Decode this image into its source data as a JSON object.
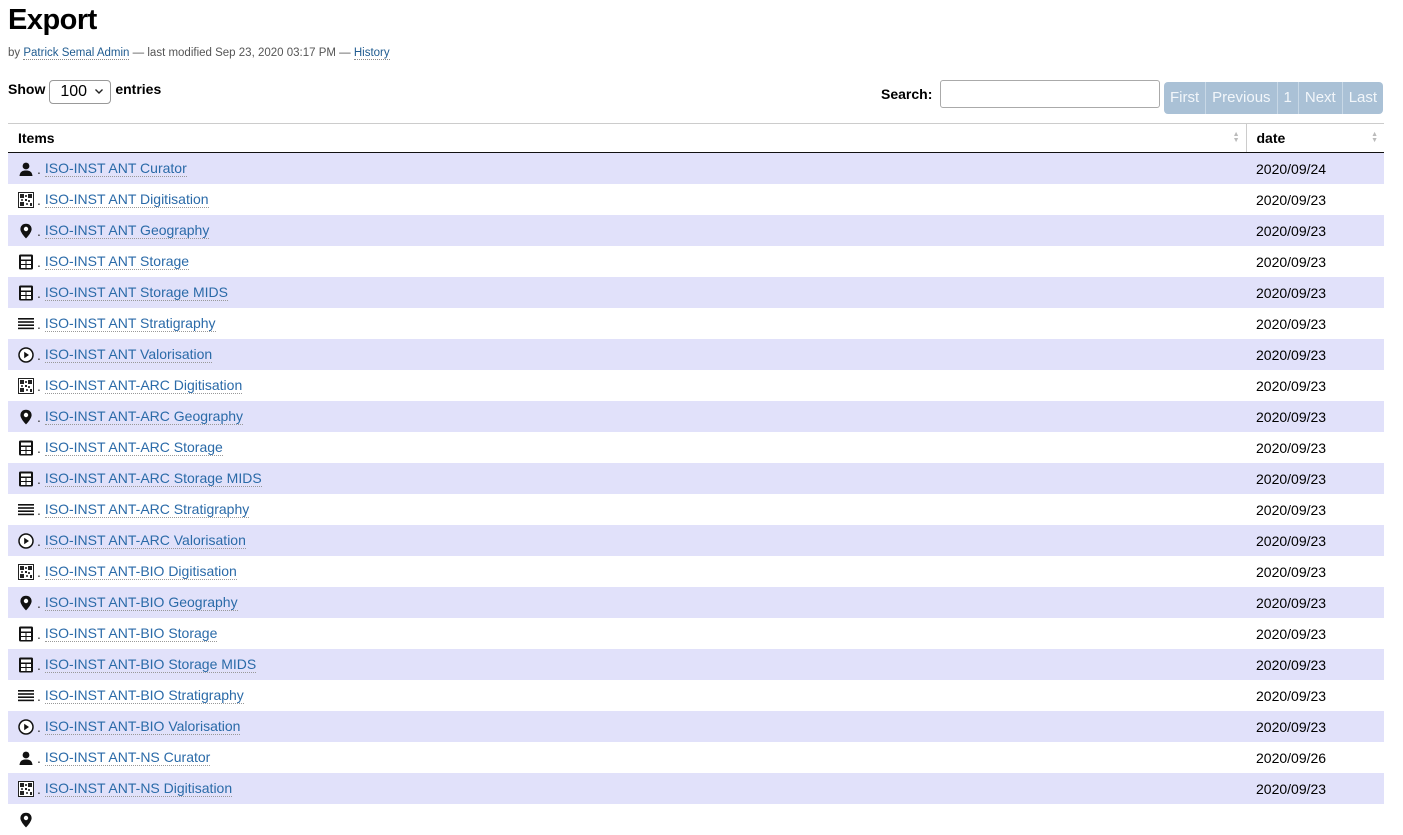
{
  "page": {
    "title": "Export",
    "byline_prefix": "by",
    "author": "Patrick Semal Admin",
    "modified": "— last modified Sep 23, 2020 03:17 PM —",
    "history": "History"
  },
  "controls": {
    "show_label": "Show",
    "entries_value": "100",
    "entries_label": "entries",
    "search_label": "Search:",
    "search_value": "",
    "pager": [
      "First",
      "Previous",
      "1",
      "Next",
      "Last"
    ]
  },
  "table": {
    "columns": [
      "Items",
      "date"
    ],
    "rows": [
      {
        "icon": "person-icon",
        "label": "ISO-INST ANT Curator",
        "date": "2020/09/24"
      },
      {
        "icon": "qr-code-icon",
        "label": "ISO-INST ANT Digitisation",
        "date": "2020/09/23"
      },
      {
        "icon": "map-pin-icon",
        "label": "ISO-INST ANT Geography",
        "date": "2020/09/23"
      },
      {
        "icon": "storage-cabinet-icon",
        "label": "ISO-INST ANT Storage",
        "date": "2020/09/23"
      },
      {
        "icon": "storage-cabinet-icon",
        "label": "ISO-INST ANT Storage MIDS",
        "date": "2020/09/23"
      },
      {
        "icon": "stratigraphy-layers-icon",
        "label": "ISO-INST ANT Stratigraphy",
        "date": "2020/09/23"
      },
      {
        "icon": "play-circle-icon",
        "label": "ISO-INST ANT Valorisation",
        "date": "2020/09/23"
      },
      {
        "icon": "qr-code-icon",
        "label": "ISO-INST ANT-ARC Digitisation",
        "date": "2020/09/23"
      },
      {
        "icon": "map-pin-icon",
        "label": "ISO-INST ANT-ARC Geography",
        "date": "2020/09/23"
      },
      {
        "icon": "storage-cabinet-icon",
        "label": "ISO-INST ANT-ARC Storage",
        "date": "2020/09/23"
      },
      {
        "icon": "storage-cabinet-icon",
        "label": "ISO-INST ANT-ARC Storage MIDS",
        "date": "2020/09/23"
      },
      {
        "icon": "stratigraphy-layers-icon",
        "label": "ISO-INST ANT-ARC Stratigraphy",
        "date": "2020/09/23"
      },
      {
        "icon": "play-circle-icon",
        "label": "ISO-INST ANT-ARC Valorisation",
        "date": "2020/09/23"
      },
      {
        "icon": "qr-code-icon",
        "label": "ISO-INST ANT-BIO Digitisation",
        "date": "2020/09/23"
      },
      {
        "icon": "map-pin-icon",
        "label": "ISO-INST ANT-BIO Geography",
        "date": "2020/09/23"
      },
      {
        "icon": "storage-cabinet-icon",
        "label": "ISO-INST ANT-BIO Storage",
        "date": "2020/09/23"
      },
      {
        "icon": "storage-cabinet-icon",
        "label": "ISO-INST ANT-BIO Storage MIDS",
        "date": "2020/09/23"
      },
      {
        "icon": "stratigraphy-layers-icon",
        "label": "ISO-INST ANT-BIO Stratigraphy",
        "date": "2020/09/23"
      },
      {
        "icon": "play-circle-icon",
        "label": "ISO-INST ANT-BIO Valorisation",
        "date": "2020/09/23"
      },
      {
        "icon": "person-icon",
        "label": "ISO-INST ANT-NS Curator",
        "date": "2020/09/26"
      },
      {
        "icon": "qr-code-icon",
        "label": "ISO-INST ANT-NS Digitisation",
        "date": "2020/09/23"
      },
      {
        "icon": "map-pin-icon",
        "label": "",
        "date": ""
      }
    ]
  },
  "colors": {
    "link": "#2a6aa8",
    "row_stripe": "#e1e1fa",
    "pager_bg": "#aac1d6"
  }
}
